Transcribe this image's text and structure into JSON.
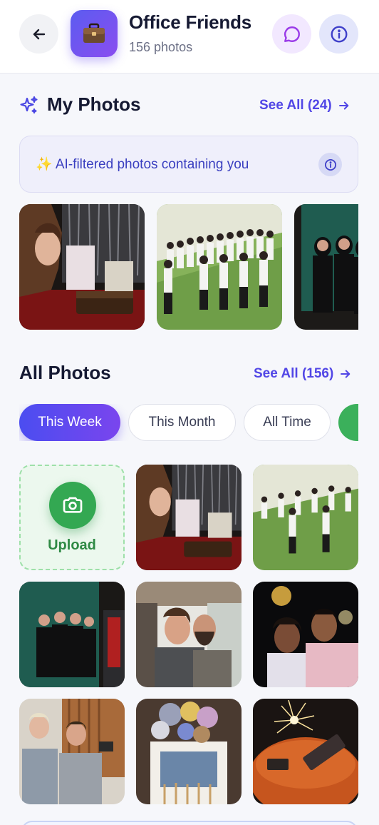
{
  "header": {
    "back_icon": "arrow-left-icon",
    "album_icon": "briefcase-icon",
    "title": "Office Friends",
    "subtitle": "156 photos",
    "chat_icon": "chat-bubble-icon",
    "info_icon": "info-icon"
  },
  "my_photos": {
    "icon": "sparkles-icon",
    "title": "My Photos",
    "see_all": "See All (24)",
    "banner_text": "✨ AI-filtered photos containing you",
    "photos": [
      {
        "subject": "birthday party with cake"
      },
      {
        "subject": "group photo on grass"
      },
      {
        "subject": "photo booth group"
      }
    ]
  },
  "all_photos": {
    "title": "All Photos",
    "see_all": "See All (156)",
    "filters": [
      "This Week",
      "This Month",
      "All Time"
    ],
    "active_filter": "This Week",
    "upload_label": "Upload",
    "photos": [
      {
        "subject": "birthday party with cake"
      },
      {
        "subject": "group photo on grass"
      },
      {
        "subject": "photo booth group"
      },
      {
        "subject": "laughing couple on balcony"
      },
      {
        "subject": "couple portrait at night"
      },
      {
        "subject": "colleagues taking selfie"
      },
      {
        "subject": "party balloons"
      },
      {
        "subject": "birthday cake with sparkler"
      }
    ]
  },
  "colors": {
    "accent": "#5146e6",
    "gradient_start": "#4b4df0",
    "gradient_end": "#7a45ee",
    "upload_green": "#33a852"
  }
}
